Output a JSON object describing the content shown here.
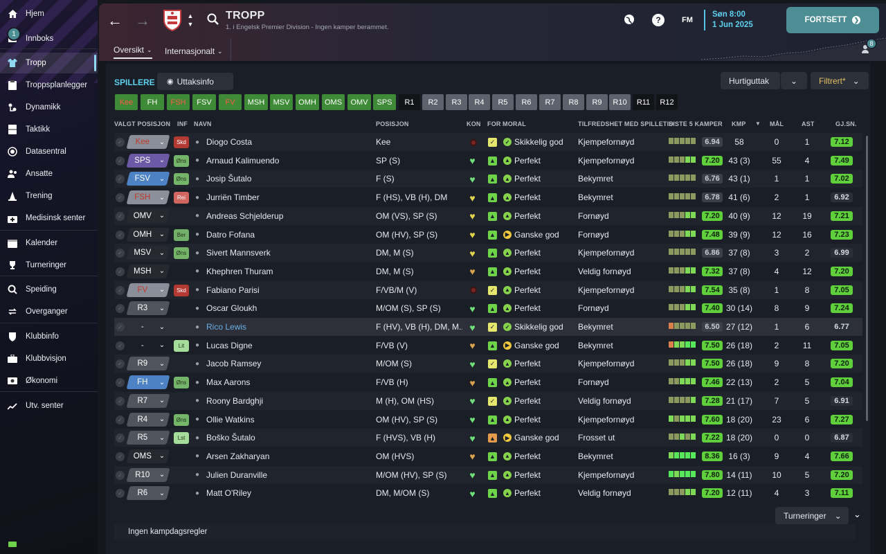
{
  "sidebar": {
    "inbox_count": "1",
    "items": [
      {
        "label": "Hjem",
        "icon": "home-icon"
      },
      {
        "label": "Innboks",
        "icon": "inbox-icon"
      },
      {
        "label": "Tropp",
        "icon": "squad-shirt-icon",
        "active": true
      },
      {
        "label": "Troppsplanlegger",
        "icon": "clipboard-icon"
      },
      {
        "label": "Dynamikk",
        "icon": "dynamics-icon"
      },
      {
        "label": "Taktikk",
        "icon": "tactics-board-icon"
      },
      {
        "label": "Datasentral",
        "icon": "data-hub-icon"
      },
      {
        "label": "Ansatte",
        "icon": "staff-icon"
      },
      {
        "label": "Trening",
        "icon": "training-cone-icon"
      },
      {
        "label": "Medisinsk senter",
        "icon": "medical-kit-icon"
      },
      {
        "label": "Kalender",
        "icon": "calendar-icon"
      },
      {
        "label": "Turneringer",
        "icon": "trophy-icon"
      },
      {
        "label": "Speiding",
        "icon": "magnifier-icon"
      },
      {
        "label": "Overganger",
        "icon": "transfers-icon"
      },
      {
        "label": "Klubbinfo",
        "icon": "shield-icon"
      },
      {
        "label": "Klubbvisjon",
        "icon": "briefcase-icon"
      },
      {
        "label": "Økonomi",
        "icon": "money-icon"
      },
      {
        "label": "Utv. senter",
        "icon": "development-chart-icon"
      }
    ]
  },
  "header": {
    "title": "TROPP",
    "subtitle": "1. i Engelsk Premier Division - Ingen kamper berammet.",
    "tabs": [
      "Oversikt",
      "Internasjonalt"
    ],
    "date_day": "Søn 8:00",
    "date_date": "1 Jun 2025",
    "fm_label": "FM",
    "help_label": "?",
    "continue_label": "FORTSETT",
    "notif_count": "8"
  },
  "toolbar": {
    "section_title": "SPILLERE",
    "uttaksinfo_label": "Uttaksinfo",
    "quickpick_label": "Hurtiguttak",
    "filter_label": "Filtrert*"
  },
  "position_tags": [
    {
      "label": "Kee",
      "style": "red"
    },
    {
      "label": "FH",
      "style": "green"
    },
    {
      "label": "FSH",
      "style": "red"
    },
    {
      "label": "FSV",
      "style": "green"
    },
    {
      "label": "FV",
      "style": "red"
    },
    {
      "label": "MSH",
      "style": "green"
    },
    {
      "label": "MSV",
      "style": "green"
    },
    {
      "label": "OMH",
      "style": "green"
    },
    {
      "label": "OMS",
      "style": "green"
    },
    {
      "label": "OMV",
      "style": "green"
    },
    {
      "label": "SPS",
      "style": "green"
    },
    {
      "label": "R1",
      "style": "dark"
    },
    {
      "label": "R2",
      "style": "grey"
    },
    {
      "label": "R3",
      "style": "grey"
    },
    {
      "label": "R4",
      "style": "grey"
    },
    {
      "label": "R5",
      "style": "grey"
    },
    {
      "label": "R6",
      "style": "grey"
    },
    {
      "label": "R7",
      "style": "grey"
    },
    {
      "label": "R8",
      "style": "grey"
    },
    {
      "label": "R9",
      "style": "grey"
    },
    {
      "label": "R10",
      "style": "grey"
    },
    {
      "label": "R11",
      "style": "dark"
    },
    {
      "label": "R12",
      "style": "dark"
    }
  ],
  "columns": {
    "selected_pos": "VALGT POSISJON",
    "inf": "INF",
    "name": "NAVN",
    "position": "POSISJON",
    "kon": "KON",
    "for": "FOR",
    "moral": "MORAL",
    "satisfaction": "TILFREDSHET MED SPILLETID",
    "last5": "SISTE 5 KAMPER",
    "kmp": "KMP",
    "goals": "MÅL",
    "assists": "AST",
    "avg": "GJ.SN."
  },
  "players": [
    {
      "sel": "Kee",
      "pill": "red",
      "inf": "Skd",
      "name": "Diogo Costa",
      "pos": "Kee",
      "kon": "dot",
      "for": "fit",
      "moral": "Skikkelig god",
      "mi": "check",
      "sat": "Kjempefornøyd",
      "form": "mmmmm",
      "l5": "6.94",
      "l5c": "grey",
      "kmp": "58",
      "mal": "0",
      "ast": "1",
      "avg": "7.12",
      "avgc": "green"
    },
    {
      "sel": "SPS",
      "pill": "purple",
      "inf": "Øns",
      "name": "Arnaud Kalimuendo",
      "pos": "SP (S)",
      "kon": "heart",
      "for": "plus",
      "moral": "Perfekt",
      "mi": "up",
      "sat": "Kjempefornøyd",
      "form": "mmmgg",
      "l5": "7.20",
      "l5c": "green",
      "kmp": "43 (3)",
      "mal": "55",
      "ast": "4",
      "avg": "7.49",
      "avgc": "green"
    },
    {
      "sel": "FSV",
      "pill": "blue",
      "inf": "Øns",
      "name": "Josip Šutalo",
      "pos": "F (S)",
      "kon": "heart",
      "for": "plus",
      "moral": "Perfekt",
      "mi": "up",
      "sat": "Bekymret",
      "form": "mmmmm",
      "l5": "6.76",
      "l5c": "grey",
      "kmp": "43 (1)",
      "mal": "1",
      "ast": "1",
      "avg": "7.02",
      "avgc": "green"
    },
    {
      "sel": "FSH",
      "pill": "red",
      "inf": "Rei",
      "name": "Jurriën Timber",
      "pos": "F (HS), VB (H), DM",
      "kon": "yheart",
      "for": "plus",
      "moral": "Perfekt",
      "mi": "up",
      "sat": "Bekymret",
      "form": "mmmmm",
      "l5": "6.78",
      "l5c": "grey",
      "kmp": "41 (6)",
      "mal": "2",
      "ast": "1",
      "avg": "6.92",
      "avgc": "grey"
    },
    {
      "sel": "OMV",
      "pill": "dark",
      "inf": "",
      "name": "Andreas Schjelderup",
      "pos": "OM (VS), SP (S)",
      "kon": "yheart",
      "for": "plus",
      "moral": "Perfekt",
      "mi": "up",
      "sat": "Fornøyd",
      "form": "mmmgg",
      "l5": "7.20",
      "l5c": "green",
      "kmp": "40 (9)",
      "mal": "12",
      "ast": "19",
      "avg": "7.21",
      "avgc": "green"
    },
    {
      "sel": "OMH",
      "pill": "dark",
      "inf": "Ber",
      "name": "Datro Fofana",
      "pos": "OM (HV), SP (S)",
      "kon": "yheart",
      "for": "plus",
      "moral": "Ganske god",
      "mi": "right",
      "sat": "Fornøyd",
      "form": "mmmgg",
      "l5": "7.48",
      "l5c": "green",
      "kmp": "39 (9)",
      "mal": "12",
      "ast": "16",
      "avg": "7.23",
      "avgc": "green"
    },
    {
      "sel": "MSV",
      "pill": "dark",
      "inf": "Øns",
      "name": "Sivert Mannsverk",
      "pos": "DM, M (S)",
      "kon": "yheart",
      "for": "plus",
      "moral": "Perfekt",
      "mi": "up",
      "sat": "Kjempefornøyd",
      "form": "mmmmm",
      "l5": "6.86",
      "l5c": "grey",
      "kmp": "37 (8)",
      "mal": "3",
      "ast": "2",
      "avg": "6.99",
      "avgc": "grey"
    },
    {
      "sel": "MSH",
      "pill": "dark",
      "inf": "",
      "name": "Khephren Thuram",
      "pos": "DM, M (S)",
      "kon": "oheart",
      "for": "plus",
      "moral": "Perfekt",
      "mi": "up",
      "sat": "Veldig fornøyd",
      "form": "mmmgg",
      "l5": "7.32",
      "l5c": "green",
      "kmp": "37 (8)",
      "mal": "4",
      "ast": "12",
      "avg": "7.20",
      "avgc": "green"
    },
    {
      "sel": "FV",
      "pill": "red",
      "inf": "Skd",
      "name": "Fabiano Parisi",
      "pos": "F/VB/M (V)",
      "kon": "dot",
      "for": "fit",
      "moral": "Perfekt",
      "mi": "up",
      "sat": "Kjempefornøyd",
      "form": "mmmgg",
      "l5": "7.54",
      "l5c": "green",
      "kmp": "35 (8)",
      "mal": "1",
      "ast": "8",
      "avg": "7.05",
      "avgc": "green"
    },
    {
      "sel": "R3",
      "pill": "grey",
      "inf": "",
      "name": "Oscar Gloukh",
      "pos": "M/OM (S), SP (S)",
      "kon": "heart",
      "for": "plus",
      "moral": "Perfekt",
      "mi": "up",
      "sat": "Fornøyd",
      "form": "mmmgg",
      "l5": "7.40",
      "l5c": "green",
      "kmp": "30 (14)",
      "mal": "8",
      "ast": "9",
      "avg": "7.24",
      "avgc": "green"
    },
    {
      "sel": "-",
      "pill": "none",
      "inf": "",
      "name": "Rico Lewis",
      "pos": "F (HV), VB (H), DM, M...",
      "kon": "heart",
      "for": "fit",
      "moral": "Skikkelig god",
      "mi": "check",
      "sat": "Bekymret",
      "form": "ommmm",
      "l5": "6.50",
      "l5c": "grey",
      "kmp": "27 (12)",
      "mal": "1",
      "ast": "6",
      "avg": "6.77",
      "avgc": "grey",
      "link": true
    },
    {
      "sel": "-",
      "pill": "none",
      "inf": "Lit",
      "name": "Lucas Digne",
      "pos": "F/VB (V)",
      "kon": "oheart",
      "for": "plus",
      "moral": "Ganske god",
      "mi": "right",
      "sat": "Bekymret",
      "form": "oggGG",
      "l5": "7.50",
      "l5c": "green",
      "kmp": "26 (18)",
      "mal": "2",
      "ast": "11",
      "avg": "7.05",
      "avgc": "green"
    },
    {
      "sel": "R9",
      "pill": "grey",
      "inf": "",
      "name": "Jacob Ramsey",
      "pos": "M/OM (S)",
      "kon": "heart",
      "for": "fit",
      "moral": "Perfekt",
      "mi": "up",
      "sat": "Kjempefornøyd",
      "form": "mmmgg",
      "l5": "7.50",
      "l5c": "green",
      "kmp": "26 (18)",
      "mal": "9",
      "ast": "8",
      "avg": "7.20",
      "avgc": "green"
    },
    {
      "sel": "FH",
      "pill": "blue",
      "inf": "Øns",
      "name": "Max Aarons",
      "pos": "F/VB (H)",
      "kon": "oheart",
      "for": "plus",
      "moral": "Perfekt",
      "mi": "up",
      "sat": "Fornøyd",
      "form": "mmggg",
      "l5": "7.46",
      "l5c": "green",
      "kmp": "22 (13)",
      "mal": "2",
      "ast": "5",
      "avg": "7.04",
      "avgc": "green"
    },
    {
      "sel": "R7",
      "pill": "grey",
      "inf": "",
      "name": "Roony Bardghji",
      "pos": "M (H), OM (HS)",
      "kon": "heart",
      "for": "fit",
      "moral": "Perfekt",
      "mi": "up",
      "sat": "Veldig fornøyd",
      "form": "mmmmg",
      "l5": "7.28",
      "l5c": "green",
      "kmp": "21 (17)",
      "mal": "7",
      "ast": "5",
      "avg": "6.91",
      "avgc": "grey"
    },
    {
      "sel": "R4",
      "pill": "grey",
      "inf": "Øns",
      "name": "Ollie Watkins",
      "pos": "OM (HV), SP (S)",
      "kon": "heart",
      "for": "plus",
      "moral": "Perfekt",
      "mi": "up",
      "sat": "Kjempefornøyd",
      "form": "gmggg",
      "l5": "7.60",
      "l5c": "green",
      "kmp": "18 (20)",
      "mal": "23",
      "ast": "6",
      "avg": "7.27",
      "avgc": "green"
    },
    {
      "sel": "R5",
      "pill": "grey",
      "inf": "Lst",
      "name": "Boško Šutalo",
      "pos": "F (HVS), VB (H)",
      "kon": "heart",
      "for": "warn",
      "moral": "Ganske god",
      "mi": "right",
      "sat": "Frosset ut",
      "form": "mmgmg",
      "l5": "7.22",
      "l5c": "green",
      "kmp": "18 (20)",
      "mal": "0",
      "ast": "0",
      "avg": "6.87",
      "avgc": "grey"
    },
    {
      "sel": "OMS",
      "pill": "dark",
      "inf": "",
      "name": "Arsen Zakharyan",
      "pos": "OM (HVS)",
      "kon": "oheart",
      "for": "plus",
      "moral": "Perfekt",
      "mi": "up",
      "sat": "Bekymret",
      "form": "gGGGG",
      "l5": "8.36",
      "l5c": "green",
      "kmp": "16 (3)",
      "mal": "9",
      "ast": "4",
      "avg": "7.66",
      "avgc": "green"
    },
    {
      "sel": "R10",
      "pill": "grey",
      "inf": "",
      "name": "Julien Duranville",
      "pos": "M/OM (HV), SP (S)",
      "kon": "heart",
      "for": "plus",
      "moral": "Perfekt",
      "mi": "up",
      "sat": "Kjempefornøyd",
      "form": "GgGGG",
      "l5": "7.80",
      "l5c": "green",
      "kmp": "14 (11)",
      "mal": "10",
      "ast": "5",
      "avg": "7.20",
      "avgc": "green"
    },
    {
      "sel": "R6",
      "pill": "grey",
      "inf": "",
      "name": "Matt O'Riley",
      "pos": "DM, M/OM (S)",
      "kon": "heart",
      "for": "up",
      "moral": "Perfekt",
      "mi": "up",
      "sat": "Veldig fornøyd",
      "form": "mmmgg",
      "l5": "7.20",
      "l5c": "green",
      "kmp": "12 (11)",
      "mal": "4",
      "ast": "3",
      "avg": "7.11",
      "avgc": "green"
    }
  ],
  "footer": {
    "tournaments_label": "Turneringer",
    "rules_label": "Ingen kampdagsregler"
  },
  "colors": {
    "accent": "#5ed1ee",
    "green": "#6fd34a",
    "rating_green": "#5fcf3c",
    "red": "#c0392b",
    "blue_pill": "#4d83c4",
    "purple_pill": "#6d5aa6"
  }
}
